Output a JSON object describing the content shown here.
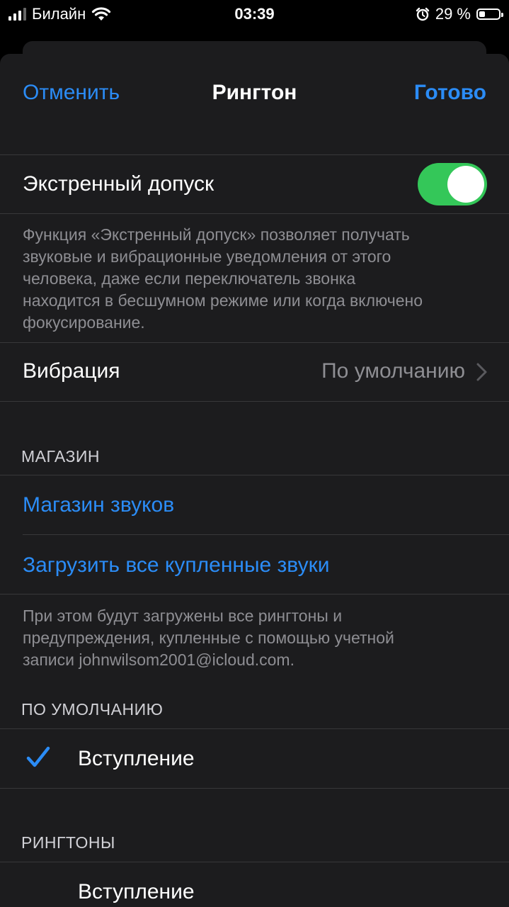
{
  "status_bar": {
    "carrier": "Билайн",
    "time": "03:39",
    "battery_percent": "29 %",
    "battery_level": 0.29
  },
  "nav": {
    "cancel": "Отменить",
    "title": "Рингтон",
    "done": "Готово"
  },
  "emergency": {
    "label": "Экстренный допуск",
    "enabled": true,
    "footer_lines": [
      "Функция «Экстренный допуск» позволяет получать",
      "звуковые и вибрационные уведомления от этого",
      "человека, даже если переключатель звонка",
      "находится в бесшумном режиме или когда включено",
      "фокусирование."
    ]
  },
  "vibration": {
    "label": "Вибрация",
    "value": "По умолчанию"
  },
  "store": {
    "header": "МАГАЗИН",
    "tone_store": "Магазин звуков",
    "download_all": "Загрузить все купленные звуки",
    "footer_lines": [
      "При этом будут загружены все рингтоны и",
      "предупреждения, купленные с помощью учетной",
      "записи johnwilsom2001@icloud.com."
    ]
  },
  "default": {
    "header": "ПО УМОЛЧАНИЮ",
    "selected_item": "Вступление"
  },
  "ringtones": {
    "header": "РИНГТОНЫ",
    "first_item": "Вступление"
  },
  "colors": {
    "accent": "#2b8cf6",
    "toggle_on": "#34c759",
    "background": "#1c1c1e"
  }
}
